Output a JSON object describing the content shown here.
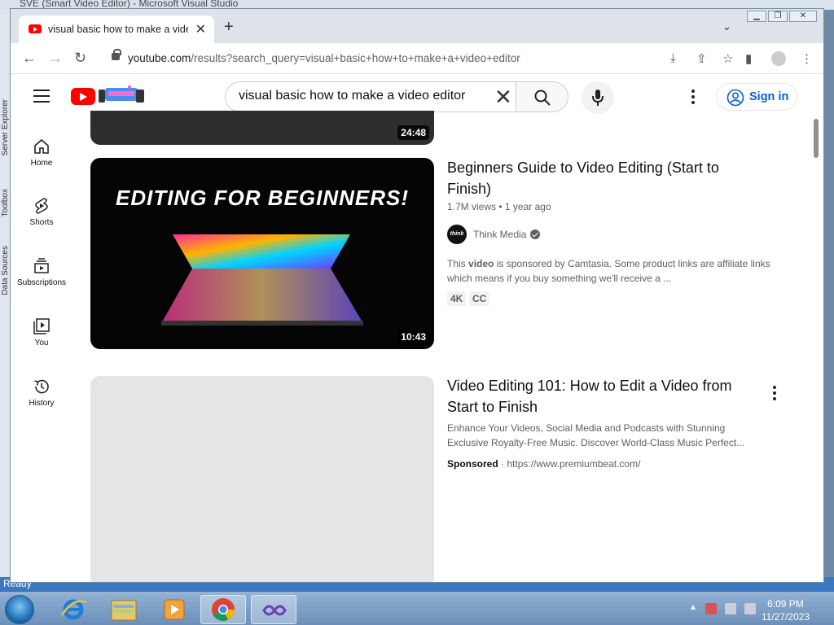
{
  "background_window": {
    "title": "SVE (Smart Video Editor) - Microsoft Visual Studio",
    "status": "Ready",
    "side_labels": [
      "Server Explorer",
      "Toolbox",
      "Data Sources"
    ]
  },
  "browser": {
    "tab_title": "visual basic how to make a video editor - YouTube",
    "url_host": "youtube.com",
    "url_rest": "/results?search_query=visual+basic+how+to+make+a+video+editor"
  },
  "youtube": {
    "search_value": "visual basic how to make a video editor",
    "sign_in_label": "Sign in",
    "sidebar": [
      {
        "label": "Home"
      },
      {
        "label": "Shorts"
      },
      {
        "label": "Subscriptions"
      },
      {
        "label": "You"
      },
      {
        "label": "History"
      }
    ],
    "results": {
      "partial": {
        "duration": "24:48"
      },
      "video1": {
        "title": "Beginners Guide to Video Editing (Start to Finish)",
        "thumb_text": "EDITING FOR BEGINNERS!",
        "duration": "10:43",
        "views": "1.7M views",
        "age": "1 year ago",
        "channel": "Think Media",
        "channel_avatar_text": "think",
        "desc_pre": "This ",
        "desc_bold": "video",
        "desc_post": " is sponsored by Camtasia. Some product links are affiliate links which means if you buy something we'll receive a ...",
        "badges": [
          "4K",
          "CC"
        ]
      },
      "ad": {
        "title": "Video Editing 101: How to Edit a Video from Start to Finish",
        "desc": "Enhance Your Videos, Social Media and Podcasts with Stunning Exclusive Royalty-Free Music. Discover World-Class Music Perfect...",
        "sponsored_label": "Sponsored",
        "link": "https://www.premiumbeat.com/"
      }
    }
  },
  "taskbar": {
    "time": "6:09 PM",
    "date": "11/27/2023"
  },
  "colors": {
    "yt_red": "#ff0000",
    "link_blue": "#065fd4",
    "taskbar": "#6b8fb8"
  }
}
